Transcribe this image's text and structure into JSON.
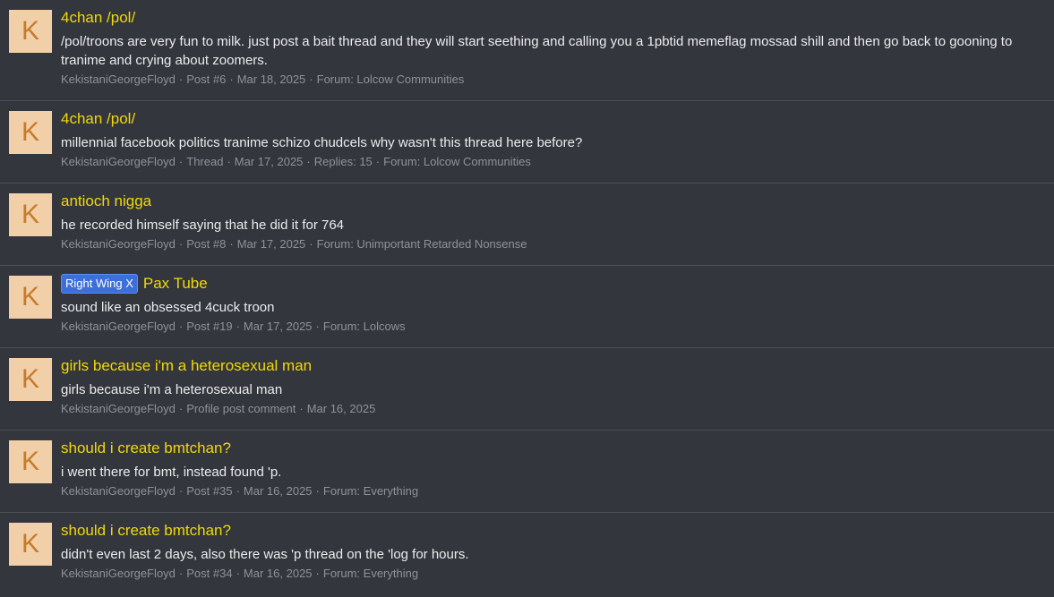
{
  "results": [
    {
      "avatar_letter": "K",
      "label": "",
      "title": "4chan /pol/",
      "snippet": "/pol/troons are very fun to milk. just post a bait thread and they will start seething and calling you a 1pbtid memeflag mossad shill and then go back to gooning to tranime and crying about zoomers.",
      "user": "KekistaniGeorgeFloyd",
      "type": "Post #6",
      "date": "Mar 18, 2025",
      "extra": "",
      "forum": "Forum: Lolcow Communities"
    },
    {
      "avatar_letter": "K",
      "label": "",
      "title": "4chan /pol/",
      "snippet": "millennial facebook politics tranime schizo chudcels why wasn't this thread here before?",
      "user": "KekistaniGeorgeFloyd",
      "type": "Thread",
      "date": "Mar 17, 2025",
      "extra": "Replies: 15",
      "forum": "Forum: Lolcow Communities"
    },
    {
      "avatar_letter": "K",
      "label": "",
      "title": "antioch nigga",
      "snippet": "he recorded himself saying that he did it for 764",
      "user": "KekistaniGeorgeFloyd",
      "type": "Post #8",
      "date": "Mar 17, 2025",
      "extra": "",
      "forum": "Forum: Unimportant Retarded Nonsense"
    },
    {
      "avatar_letter": "K",
      "label": "Right Wing X",
      "title": "Pax Tube",
      "snippet": "sound like an obsessed 4cuck troon",
      "user": "KekistaniGeorgeFloyd",
      "type": "Post #19",
      "date": "Mar 17, 2025",
      "extra": "",
      "forum": "Forum: Lolcows"
    },
    {
      "avatar_letter": "K",
      "label": "",
      "title": "girls because i'm a heterosexual man",
      "snippet": "girls because i'm a heterosexual man",
      "user": "KekistaniGeorgeFloyd",
      "type": "Profile post comment",
      "date": "Mar 16, 2025",
      "extra": "",
      "forum": ""
    },
    {
      "avatar_letter": "K",
      "label": "",
      "title": "should i create bmtchan?",
      "snippet": "i went there for bmt, instead found 'p.",
      "user": "KekistaniGeorgeFloyd",
      "type": "Post #35",
      "date": "Mar 16, 2025",
      "extra": "",
      "forum": "Forum: Everything"
    },
    {
      "avatar_letter": "K",
      "label": "",
      "title": "should i create bmtchan?",
      "snippet": "didn't even last 2 days, also there was 'p thread on the 'log for hours.",
      "user": "KekistaniGeorgeFloyd",
      "type": "Post #34",
      "date": "Mar 16, 2025",
      "extra": "",
      "forum": "Forum: Everything"
    }
  ],
  "meta_separator": "·",
  "colors": {
    "background": "#33363d",
    "title": "#f0d80a",
    "avatar_bg": "#f1cfa9",
    "avatar_letter": "#c77a2a",
    "label_bg": "#3c6fd9",
    "meta": "#8f9297"
  }
}
